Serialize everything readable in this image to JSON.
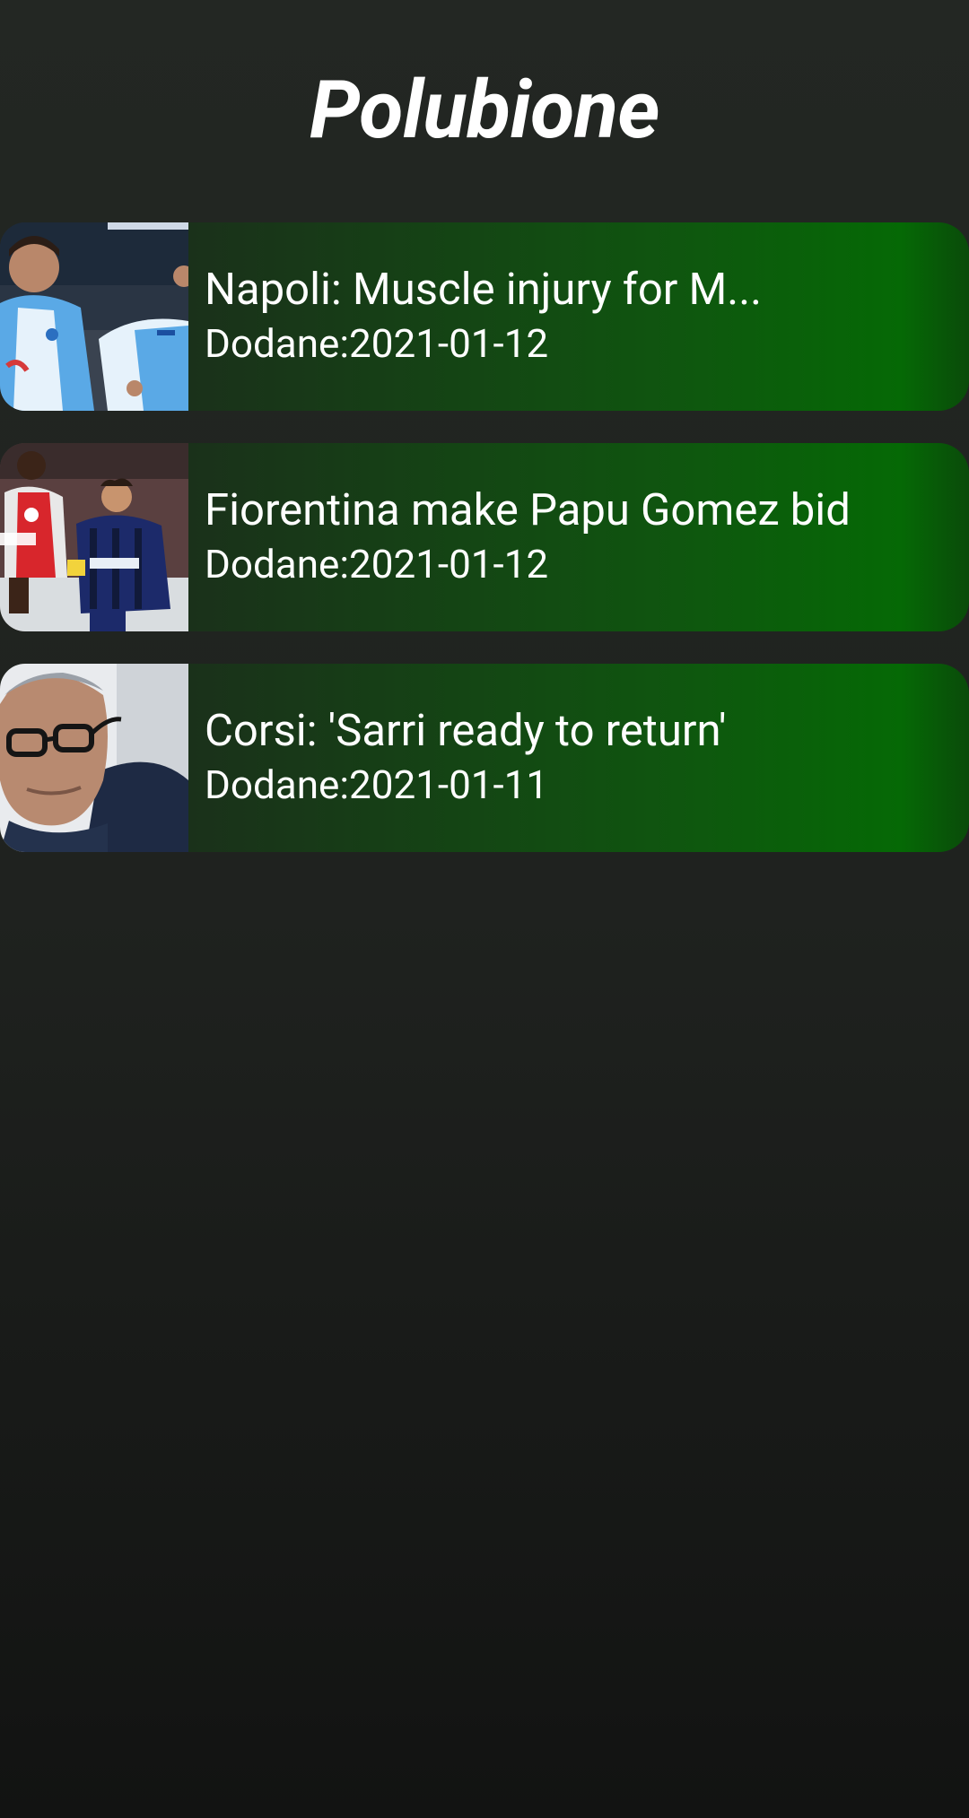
{
  "app": {
    "title": "Polubione"
  },
  "articles": [
    {
      "headline": "Napoli: Muscle injury for M...",
      "date": "Dodane:2021-01-12",
      "thumbnail": "football-players-napoli-photo"
    },
    {
      "headline": "Fiorentina make Papu Gomez bid",
      "date": "Dodane:2021-01-12",
      "thumbnail": "football-players-ajax-atalanta-photo"
    },
    {
      "headline": "Corsi: 'Sarri ready to return'",
      "date": "Dodane:2021-01-11",
      "thumbnail": "coach-portrait-photo"
    }
  ]
}
